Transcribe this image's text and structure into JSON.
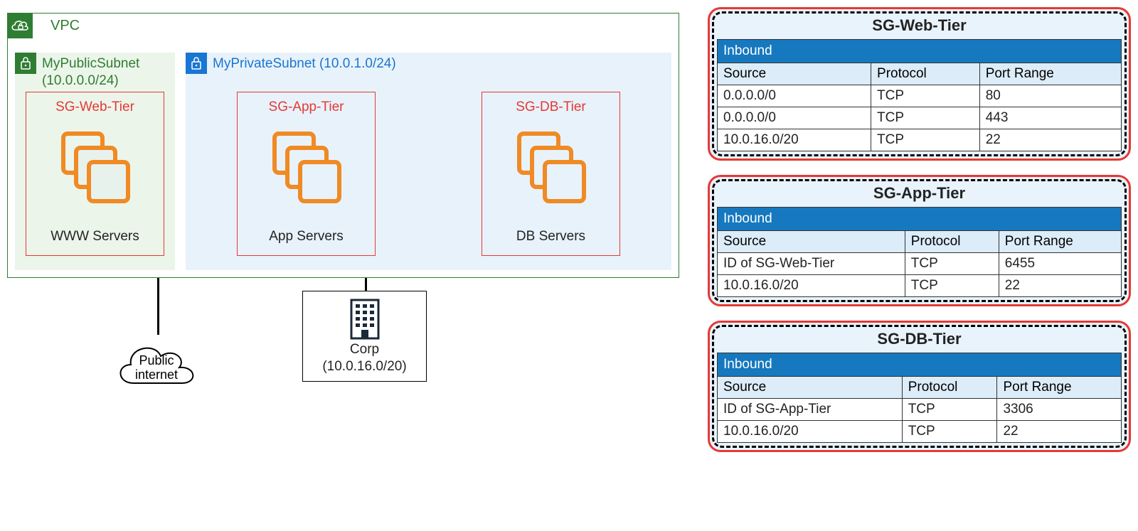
{
  "vpc": {
    "label": "VPC"
  },
  "public_subnet": {
    "label": "MyPublicSubnet (10.0.0.0/24)",
    "sg_title": "SG-Web-Tier",
    "servers": "WWW Servers"
  },
  "private_subnet": {
    "label": "MyPrivateSubnet (10.0.1.0/24)",
    "sg_app": {
      "title": "SG-App-Tier",
      "servers": "App Servers"
    },
    "sg_db": {
      "title": "SG-DB-Tier",
      "servers": "DB Servers"
    }
  },
  "external": {
    "internet": "Public internet",
    "corp_name": "Corp",
    "corp_cidr": "(10.0.16.0/20)"
  },
  "rules": {
    "inbound_label": "Inbound",
    "headers": {
      "source": "Source",
      "protocol": "Protocol",
      "port": "Port Range"
    }
  },
  "sg_web": {
    "title": "SG-Web-Tier",
    "rows": [
      {
        "source": "0.0.0.0/0",
        "protocol": "TCP",
        "port": "80"
      },
      {
        "source": "0.0.0.0/0",
        "protocol": "TCP",
        "port": "443"
      },
      {
        "source": "10.0.16.0/20",
        "protocol": "TCP",
        "port": "22"
      }
    ]
  },
  "sg_app": {
    "title": "SG-App-Tier",
    "rows": [
      {
        "source": "ID of SG-Web-Tier",
        "protocol": "TCP",
        "port": "6455"
      },
      {
        "source": "10.0.16.0/20",
        "protocol": "TCP",
        "port": "22"
      }
    ]
  },
  "sg_db": {
    "title": "SG-DB-Tier",
    "rows": [
      {
        "source": "ID of SG-App-Tier",
        "protocol": "TCP",
        "port": "3306"
      },
      {
        "source": "10.0.16.0/20",
        "protocol": "TCP",
        "port": "22"
      }
    ]
  }
}
